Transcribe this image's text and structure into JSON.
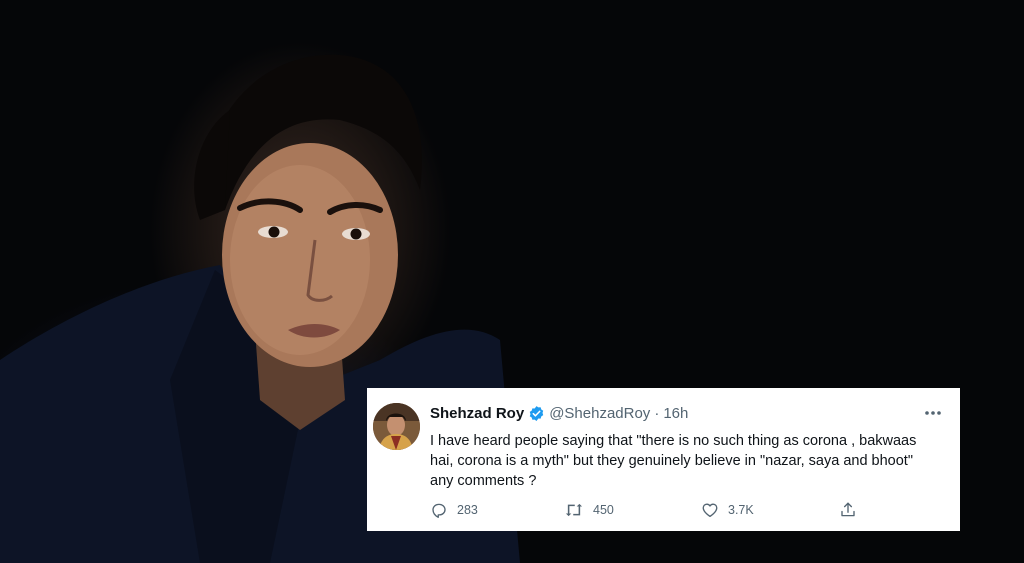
{
  "tweet": {
    "author_name": "Shehzad Roy",
    "handle": "@ShehzadRoy",
    "separator": "·",
    "time": "16h",
    "text": "I have heard people saying that \"there is no such thing as corona , bakwaas\nhai, corona is a myth\" but they genuinely believe in \"nazar, saya and bhoot\"\nany  comments ?",
    "more_icon": "more-horizontal-icon",
    "verified_icon": "verified-badge-icon",
    "accent_color": "#1d9bf0",
    "actions": {
      "replies": "283",
      "retweets": "450",
      "likes": "3.7K"
    }
  },
  "colors": {
    "background": "#050608",
    "card": "#ffffff",
    "text": "#0f1419",
    "muted": "#536471"
  }
}
